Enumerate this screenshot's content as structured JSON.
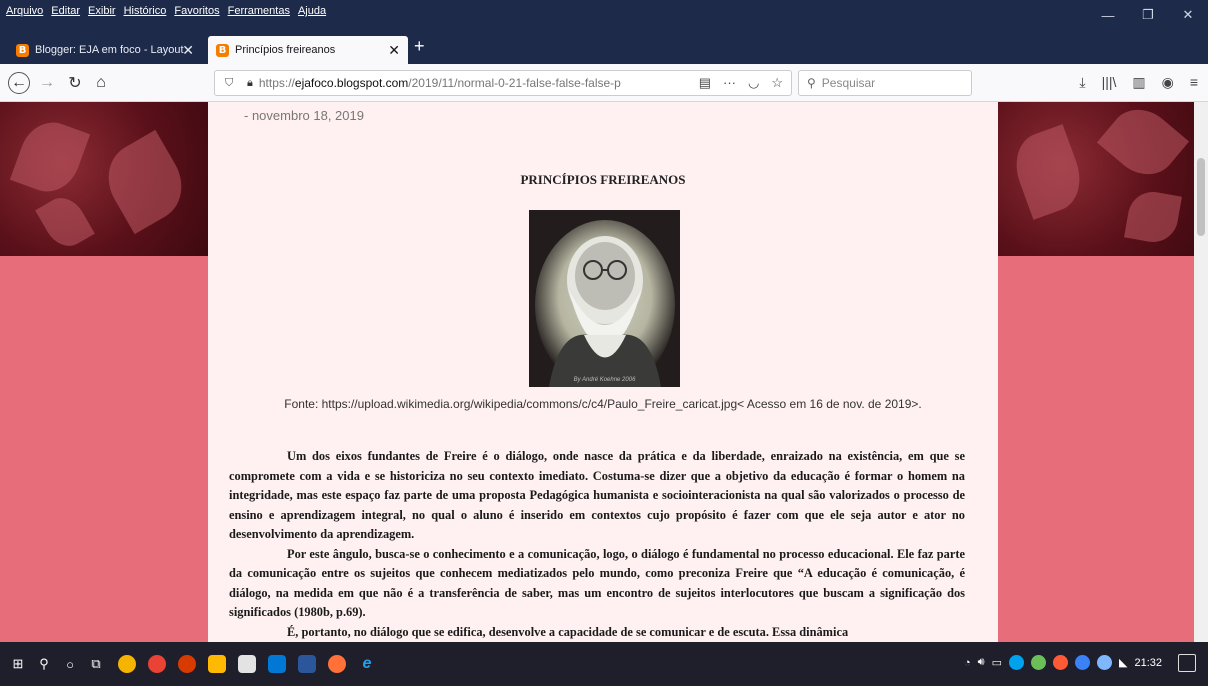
{
  "menubar": {
    "items": [
      "Arquivo",
      "Editar",
      "Exibir",
      "Histórico",
      "Favoritos",
      "Ferramentas",
      "Ajuda"
    ]
  },
  "tabs": [
    {
      "title": "Blogger: EJA em foco - Layout",
      "active": false
    },
    {
      "title": "Princípios freireanos",
      "active": true
    }
  ],
  "navbar": {
    "url_prefix": "https://",
    "url_domain": "ejafoco.blogspot.com",
    "url_path": "/2019/11/normal-0-21-false-false-false-p",
    "search_placeholder": "Pesquisar"
  },
  "post": {
    "date": "- novembro 18, 2019",
    "title": "PRINCÍPIOS FREIREANOS",
    "image_signature": "By André Koehne 2006",
    "caption": "Fonte: https://upload.wikimedia.org/wikipedia/commons/c/c4/Paulo_Freire_caricat.jpg< Acesso em 16 de nov. de 2019>.",
    "paragraphs": [
      "Um dos eixos fundantes de Freire é o diálogo, onde nasce da prática e da liberdade, enraizado na existência, em que se compromete com a vida e se historiciza no seu contexto imediato. Costuma-se dizer que a objetivo da educação é formar o homem na integridade, mas este espaço faz parte de uma proposta Pedagógica humanista e sociointeracionista na qual são valorizados o processo de ensino e aprendizagem integral, no qual o aluno é inserido em contextos cujo propósito é fazer com que ele seja autor e ator no desenvolvimento da aprendizagem.",
      "Por este ângulo, busca-se o conhecimento e a comunicação, logo, o diálogo é fundamental no processo educacional. Ele faz parte da comunicação entre os sujeitos que conhecem mediatizados pelo mundo, como preconiza Freire que “A educação é comunicação, é diálogo, na medida em que não é a transferência de saber, mas um encontro de sujeitos interlocutores que buscam a significação dos significados (1980b, p.69).",
      "É, portanto, no diálogo que se edifica, desenvolve a capacidade de se comunicar e de escuta. Essa dinâmica"
    ]
  },
  "taskbar": {
    "clock": "21:32"
  },
  "colors": {
    "chrome_dark": "#1e2a4a",
    "page_bg": "#e66d79",
    "post_bg": "#fff1f2",
    "tab_favicon": "#f57d00"
  }
}
